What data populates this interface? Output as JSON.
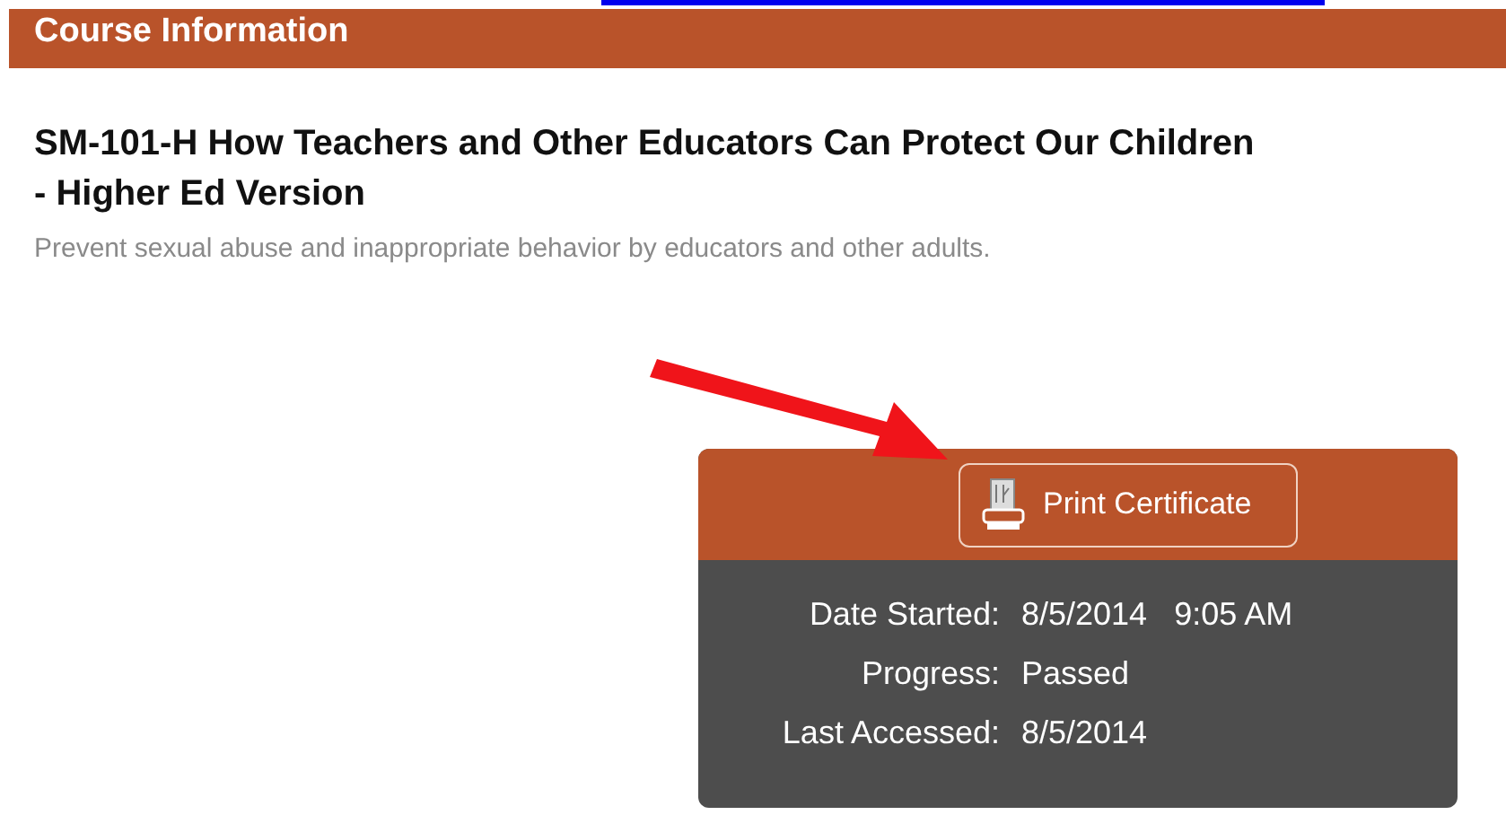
{
  "section_header": {
    "title": "Course Information"
  },
  "course": {
    "title": "SM-101-H How Teachers and Other Educators Can Protect Our Children - Higher Ed Version",
    "description": "Prevent sexual abuse and inappropriate behavior by educators and other adults."
  },
  "status_card": {
    "button": {
      "label": "Print Certificate"
    },
    "details": [
      {
        "label": "Date Started:",
        "value": "8/5/2014   9:05 AM"
      },
      {
        "label": "Progress:",
        "value": "Passed"
      },
      {
        "label": "Last Accessed:",
        "value": "8/5/2014"
      }
    ]
  }
}
